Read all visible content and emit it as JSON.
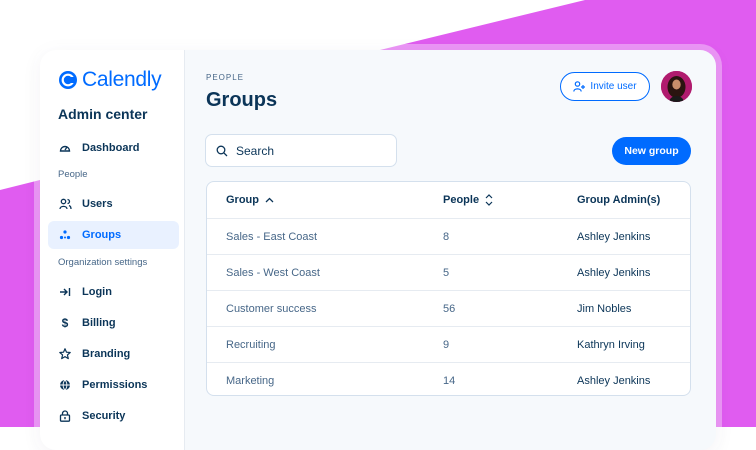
{
  "brand": {
    "name": "Calendly",
    "accent": "#006bff",
    "background_accent": "#e05cf0"
  },
  "sidebar": {
    "title": "Admin center",
    "items": [
      {
        "label": "Dashboard",
        "icon": "dashboard-gauge-icon"
      },
      {
        "label": "Users",
        "icon": "users-icon"
      },
      {
        "label": "Groups",
        "icon": "groups-icon",
        "active": true
      },
      {
        "label": "Login",
        "icon": "login-arrow-icon"
      },
      {
        "label": "Billing",
        "icon": "dollar-icon"
      },
      {
        "label": "Branding",
        "icon": "star-icon"
      },
      {
        "label": "Permissions",
        "icon": "globe-icon"
      },
      {
        "label": "Security",
        "icon": "lock-icon"
      }
    ],
    "sections": {
      "people": "People",
      "org_settings": "Organization settings"
    }
  },
  "header": {
    "eyebrow": "PEOPLE",
    "title": "Groups",
    "invite_label": "Invite user"
  },
  "search": {
    "placeholder": "Search"
  },
  "new_group_label": "New group",
  "table": {
    "columns": [
      "Group",
      "People",
      "Group Admin(s)"
    ],
    "rows": [
      {
        "group": "Sales - East Coast",
        "people": "8",
        "admin": "Ashley Jenkins"
      },
      {
        "group": "Sales - West Coast",
        "people": "5",
        "admin": "Ashley Jenkins"
      },
      {
        "group": "Customer success",
        "people": "56",
        "admin": "Jim Nobles"
      },
      {
        "group": "Recruiting",
        "people": "9",
        "admin": "Kathryn Irving"
      },
      {
        "group": "Marketing",
        "people": "14",
        "admin": "Ashley Jenkins"
      }
    ]
  }
}
